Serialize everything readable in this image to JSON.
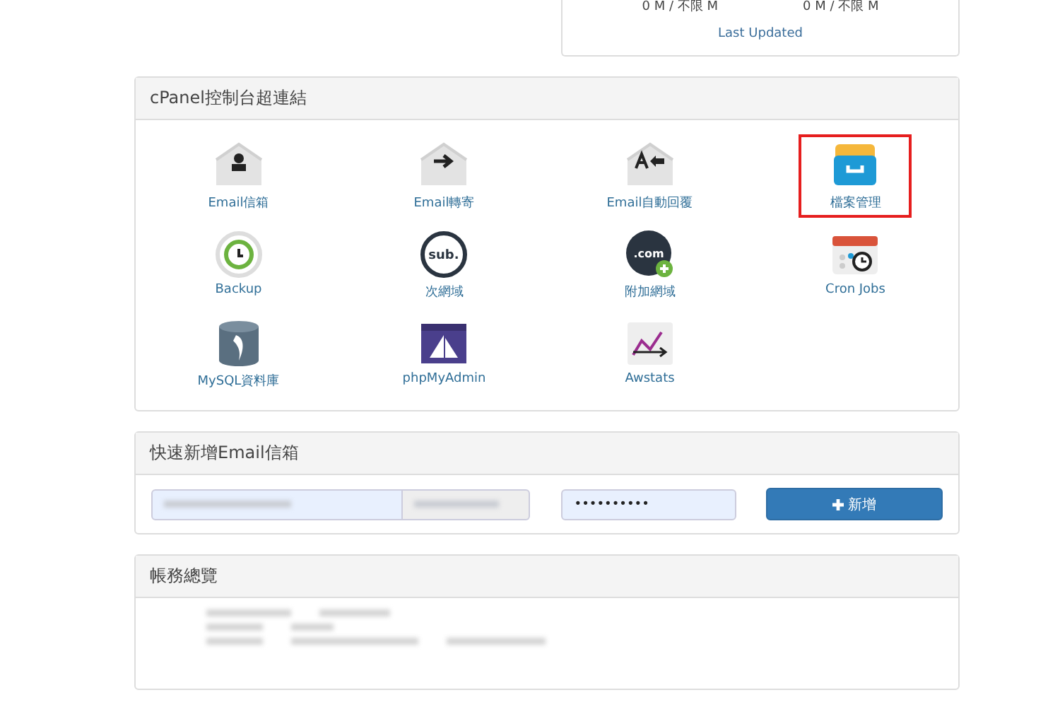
{
  "stats_card": {
    "values": [
      "0 M / 不限 M",
      "0 M / 不限 M"
    ],
    "link": "Last Updated"
  },
  "links_panel": {
    "title": "cPanel控制台超連結",
    "items": [
      {
        "kind": "mail-user",
        "label": "Email信箱",
        "highlighted": false
      },
      {
        "kind": "mail-forward",
        "label": "Email轉寄",
        "highlighted": false
      },
      {
        "kind": "mail-reply",
        "label": "Email自動回覆",
        "highlighted": false
      },
      {
        "kind": "drawer",
        "label": "檔案管理",
        "highlighted": true
      },
      {
        "kind": "backup",
        "label": "Backup",
        "highlighted": false
      },
      {
        "kind": "sub",
        "icon_text": "sub.",
        "label": "次網域",
        "highlighted": false
      },
      {
        "kind": "com",
        "icon_text": ".com",
        "label": "附加網域",
        "highlighted": false
      },
      {
        "kind": "cron",
        "label": "Cron Jobs",
        "highlighted": false
      },
      {
        "kind": "database",
        "label": "MySQL資料庫",
        "highlighted": false
      },
      {
        "kind": "window",
        "label": "phpMyAdmin",
        "highlighted": false
      },
      {
        "kind": "chart",
        "label": "Awstats",
        "highlighted": false
      }
    ]
  },
  "email_panel": {
    "title": "快速新增Email信箱",
    "password": "••••••••••",
    "button": "新增"
  },
  "account_panel": {
    "title": "帳務總覽"
  }
}
